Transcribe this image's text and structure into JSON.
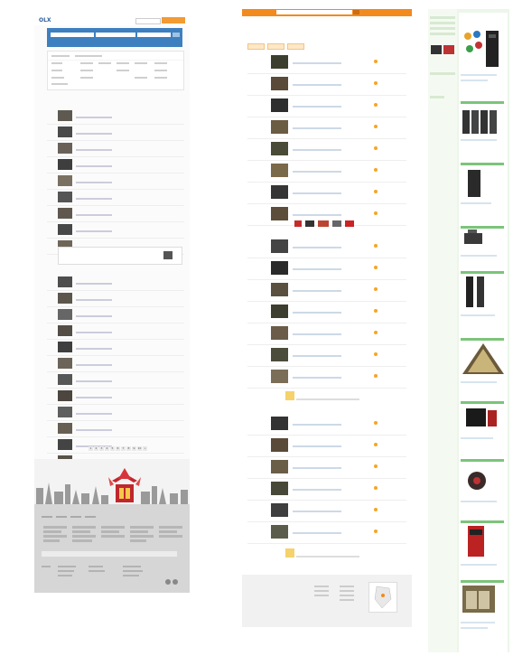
{
  "left": {
    "logo": "OLX",
    "tagline": "",
    "login_label": "",
    "post_button_label": "",
    "search": {
      "placeholder": "",
      "location": "",
      "category": ""
    },
    "breadcrumb": "",
    "items": [
      {
        "date": "",
        "title": "",
        "price": ""
      },
      {
        "date": "",
        "title": "",
        "price": ""
      },
      {
        "date": "",
        "title": "",
        "price": ""
      },
      {
        "date": "",
        "title": "",
        "price": ""
      },
      {
        "date": "",
        "title": "",
        "price": ""
      },
      {
        "date": "",
        "title": "",
        "price": ""
      },
      {
        "date": "",
        "title": "",
        "price": ""
      },
      {
        "date": "",
        "title": "",
        "price": ""
      },
      {
        "date": "",
        "title": "",
        "price": ""
      },
      {
        "date": "",
        "title": "",
        "price": ""
      },
      {
        "date": "",
        "title": "",
        "price": ""
      },
      {
        "date": "",
        "title": "",
        "price": ""
      },
      {
        "date": "",
        "title": "",
        "price": ""
      },
      {
        "date": "",
        "title": "",
        "price": ""
      },
      {
        "date": "",
        "title": "",
        "price": ""
      },
      {
        "date": "",
        "title": "",
        "price": ""
      },
      {
        "date": "",
        "title": "",
        "price": ""
      },
      {
        "date": "",
        "title": "",
        "price": ""
      },
      {
        "date": "",
        "title": "",
        "price": ""
      },
      {
        "date": "",
        "title": "",
        "price": ""
      },
      {
        "date": "",
        "title": "",
        "price": ""
      },
      {
        "date": "",
        "title": "",
        "price": ""
      }
    ],
    "promo_title": "",
    "promo_text": "",
    "pager": [
      "1",
      "2",
      "3",
      "4",
      "5",
      "6",
      "7",
      "8",
      "9",
      "10",
      "»"
    ]
  },
  "middle": {
    "logo": "",
    "breadcrumb": "",
    "title": "",
    "rows": [
      {
        "date": "",
        "title": "",
        "price": ""
      },
      {
        "date": "",
        "title": "",
        "price": ""
      },
      {
        "date": "",
        "title": "",
        "price": ""
      },
      {
        "date": "",
        "title": "",
        "price": ""
      },
      {
        "date": "",
        "title": "",
        "price": ""
      },
      {
        "date": "",
        "title": "",
        "price": ""
      },
      {
        "date": "",
        "title": "",
        "price": ""
      },
      {
        "date": "",
        "title": "",
        "price": ""
      },
      {
        "date": "",
        "title": "",
        "price": ""
      },
      {
        "date": "",
        "title": "",
        "price": ""
      },
      {
        "date": "",
        "title": "",
        "price": ""
      },
      {
        "date": "",
        "title": "",
        "price": ""
      },
      {
        "date": "",
        "title": "",
        "price": ""
      },
      {
        "date": "",
        "title": "",
        "price": ""
      },
      {
        "date": "",
        "title": "",
        "price": ""
      },
      {
        "date": "",
        "title": "",
        "price": ""
      },
      {
        "date": "",
        "title": "",
        "price": ""
      },
      {
        "date": "",
        "title": "",
        "price": ""
      },
      {
        "date": "",
        "title": "",
        "price": ""
      },
      {
        "date": "",
        "title": "",
        "price": ""
      },
      {
        "date": "",
        "title": "",
        "price": ""
      },
      {
        "date": "",
        "title": "",
        "price": ""
      },
      {
        "date": "",
        "title": "",
        "price": ""
      }
    ],
    "footer_logo": ""
  },
  "right": {
    "title": ""
  },
  "colors": {
    "olx_blue": "#3e7fbf",
    "orange": "#f28a1e",
    "green_panel": "#ecf6ea",
    "ad_red": "#a01f23"
  }
}
